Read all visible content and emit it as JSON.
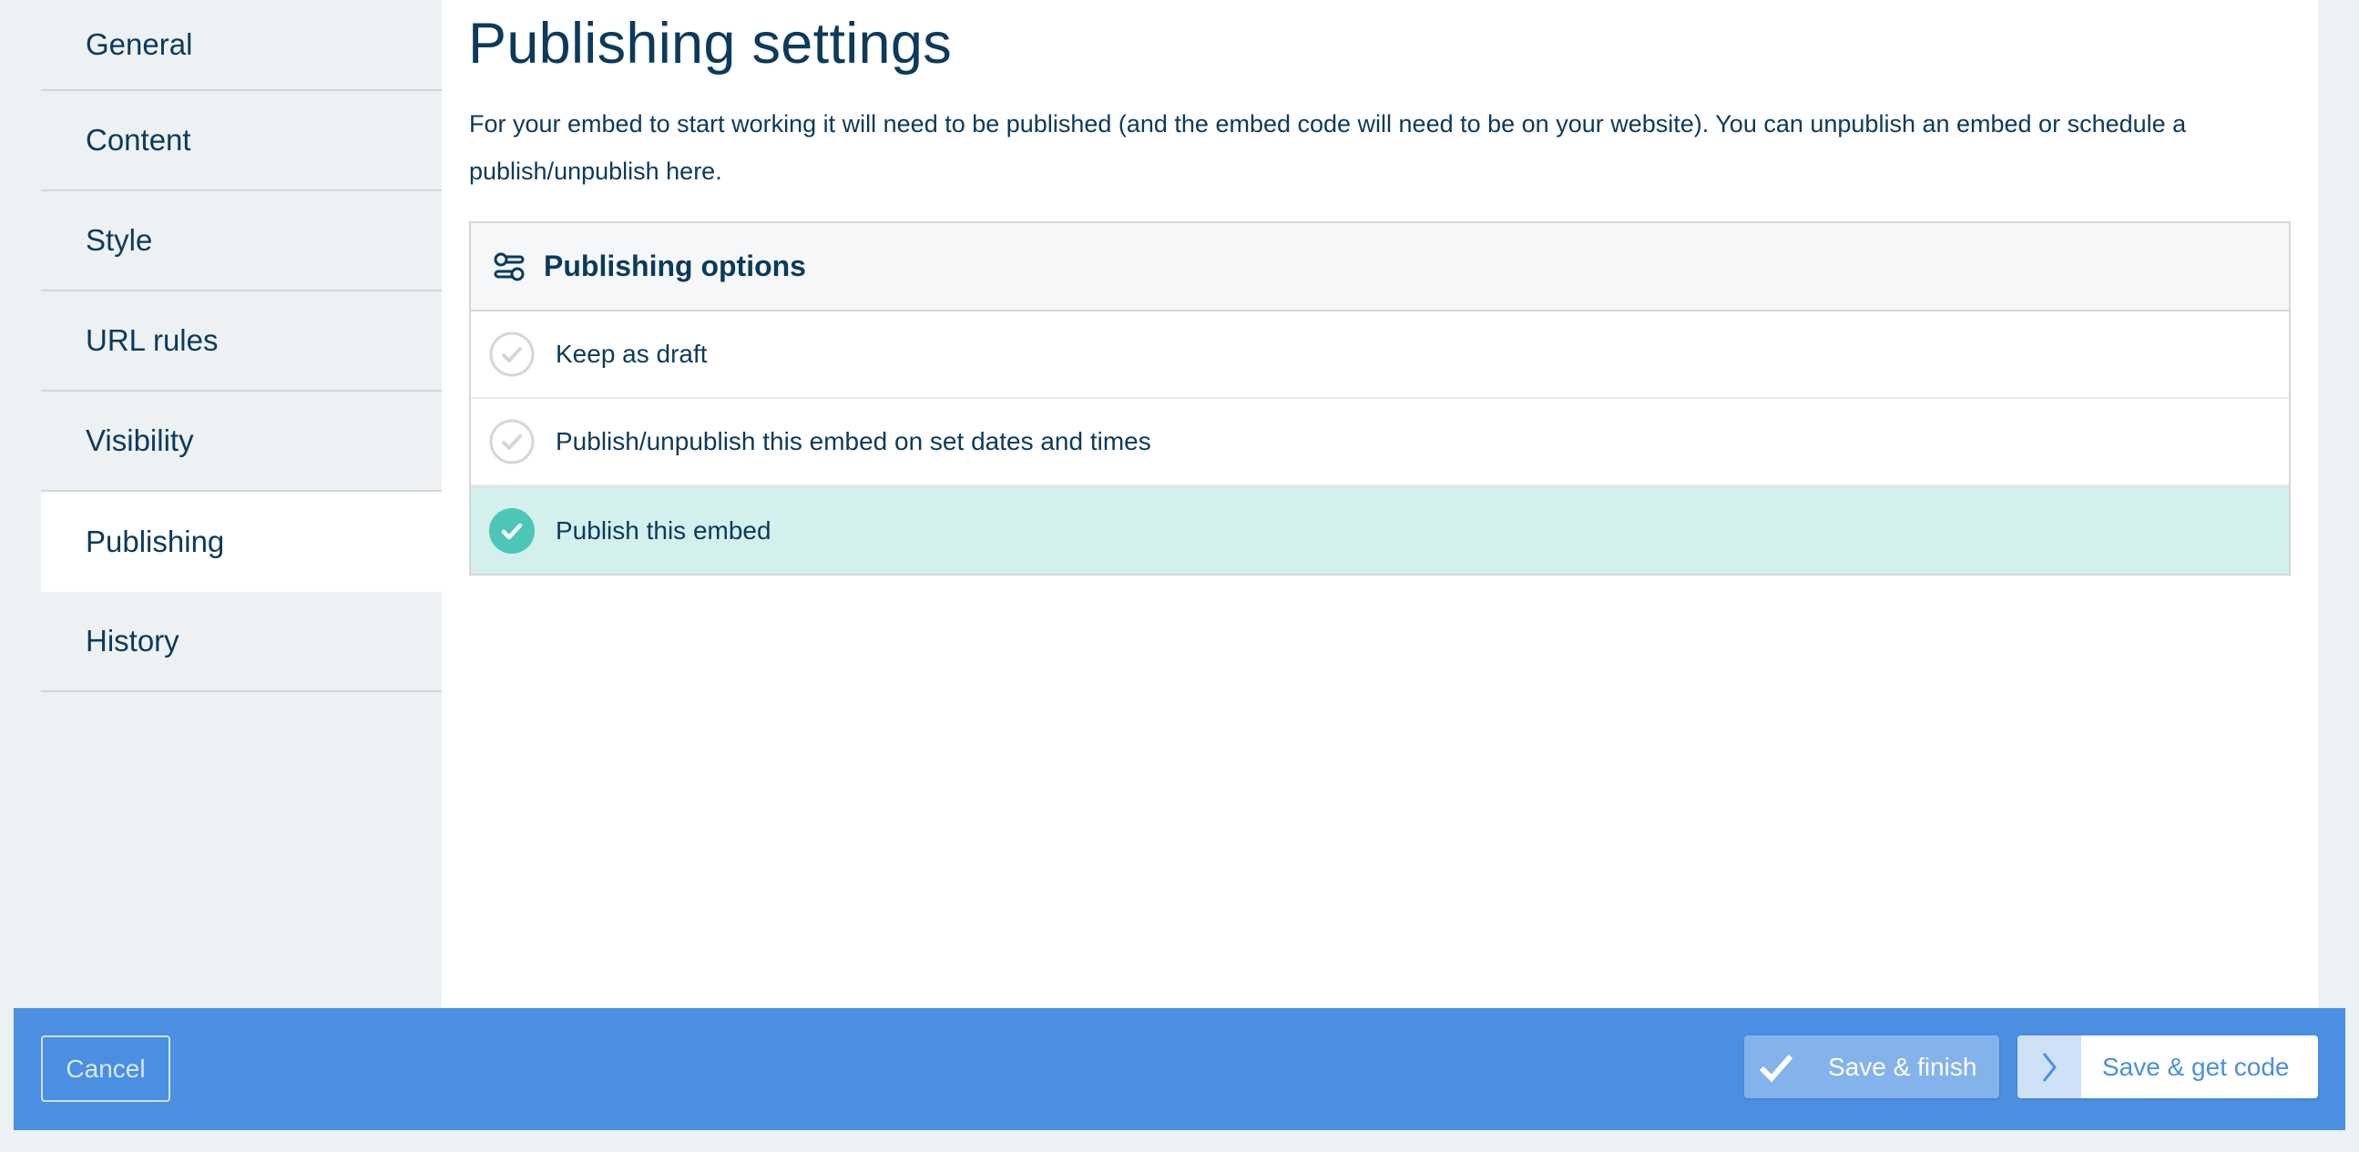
{
  "sidebar": {
    "items": [
      {
        "label": "General",
        "active": false
      },
      {
        "label": "Content",
        "active": false
      },
      {
        "label": "Style",
        "active": false
      },
      {
        "label": "URL rules",
        "active": false
      },
      {
        "label": "Visibility",
        "active": false
      },
      {
        "label": "Publishing",
        "active": true
      },
      {
        "label": "History",
        "active": false
      }
    ]
  },
  "main": {
    "title": "Publishing settings",
    "description": "For your embed to start working it will need to be published (and the embed code will need to be on your website). You can unpublish an embed or schedule a publish/unpublish here.",
    "options_panel": {
      "icon": "sliders-icon",
      "title": "Publishing options",
      "options": [
        {
          "label": "Keep as draft",
          "selected": false
        },
        {
          "label": "Publish/unpublish this embed on set dates and times",
          "selected": false
        },
        {
          "label": "Publish this embed",
          "selected": true
        }
      ]
    }
  },
  "footer": {
    "cancel_label": "Cancel",
    "save_finish_label": "Save & finish",
    "save_code_label": "Save & get code"
  },
  "colors": {
    "text": "#0b3a5c",
    "accent": "#4a8fe1",
    "selected_bg": "#d3f0ec",
    "selected_check": "#4cc7b7",
    "unselected_check": "#d6d6d6"
  }
}
